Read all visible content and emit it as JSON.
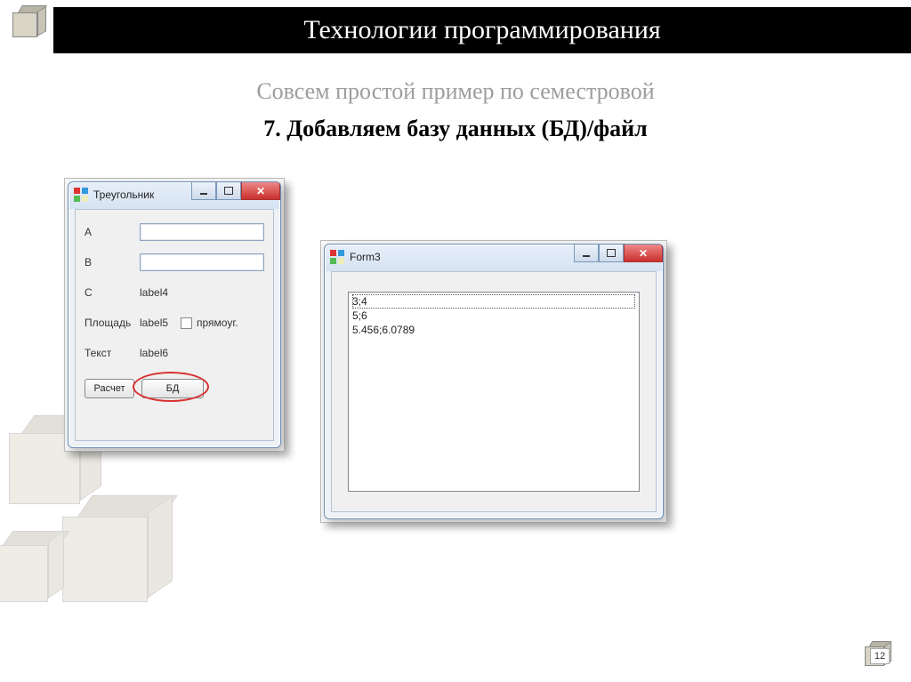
{
  "slide": {
    "title": "Технологии программирования",
    "subtitle_grey": "Совсем простой пример по семестровой",
    "subtitle_bold": "7. Добавляем базу данных (БД)/файл",
    "page_number": "12"
  },
  "form1": {
    "window_title": "Треугольник",
    "label_a": "A",
    "label_b": "B",
    "label_c": "C",
    "value_c": "label4",
    "label_area": "Площадь",
    "value_area": "label5",
    "checkbox_label": "прямоуг.",
    "label_text": "Текст",
    "value_text": "label6",
    "btn_calc": "Расчет",
    "btn_db": "БД"
  },
  "form3": {
    "window_title": "Form3",
    "items": {
      "0": "3;4",
      "1": "5;6",
      "2": "5.456;6.0789"
    }
  }
}
